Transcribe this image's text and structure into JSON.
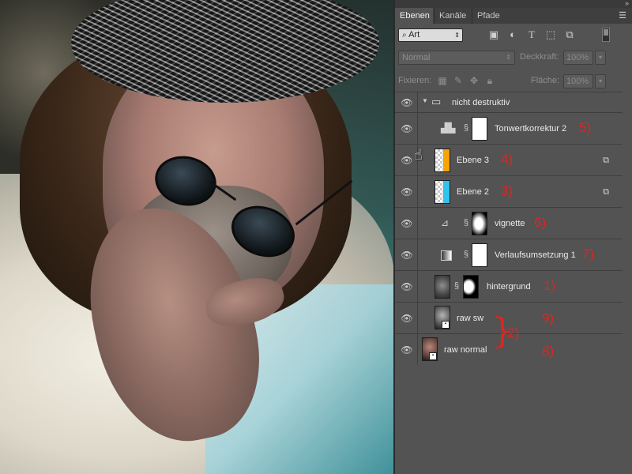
{
  "panel": {
    "tabs": [
      {
        "label": "Ebenen",
        "active": true
      },
      {
        "label": "Kanäle",
        "active": false
      },
      {
        "label": "Pfade",
        "active": false
      }
    ],
    "filter": {
      "label": "Art"
    },
    "blend_mode": "Normal",
    "opacity_label": "Deckkraft:",
    "opacity_value": "100%",
    "lock_label": "Fixieren:",
    "fill_label": "Fläche:",
    "fill_value": "100%"
  },
  "layers": {
    "group": {
      "name": "nicht destruktiv"
    },
    "items": [
      {
        "name": "Tonwertkorrektur 2",
        "annotation": "5)"
      },
      {
        "name": "Ebene 3",
        "annotation": "4)"
      },
      {
        "name": "Ebene 2",
        "annotation": "3)"
      },
      {
        "name": "vignette",
        "annotation": "6)"
      },
      {
        "name": "Verlaufsumsetzung 1",
        "annotation": "7)"
      },
      {
        "name": "hintergrund",
        "annotation": "1)"
      },
      {
        "name": "raw sw",
        "annotation": "9)"
      },
      {
        "name": "raw normal",
        "annotation": "8)"
      }
    ],
    "brace_annotation": "2)"
  },
  "colors": {
    "annotation_red": "#e02420",
    "panel_bg": "#535353",
    "ebene3_thumb": "#f5a400",
    "ebene2_thumb": "#2fc3ee"
  }
}
